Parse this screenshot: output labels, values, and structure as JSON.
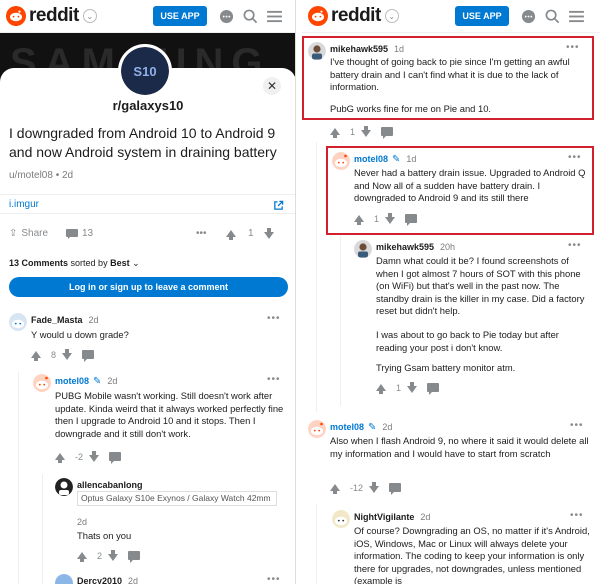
{
  "app": {
    "logo_text": "reddit",
    "use_app_label": "USE APP"
  },
  "left": {
    "banner_text": "SAMSUNG",
    "subreddit": "r/galaxys10",
    "sub_avatar_text": "S10",
    "close_glyph": "✕",
    "post": {
      "title": "I downgraded from Android 10 to Android 9 and now Android system in draining battery",
      "meta": "u/motel08 • 2d",
      "link": "i.imgur"
    },
    "actions": {
      "share": "Share",
      "comments": "13",
      "votes": "1"
    },
    "comments_header": {
      "count_label": "13 Comments",
      "sorted_by": "sorted by",
      "sort_value": "Best"
    },
    "login_button": "Log in or sign up to leave a comment",
    "comments": [
      {
        "author": "Fade_Masta",
        "age": "2d",
        "body": "Y would u down grade?",
        "score": "8"
      },
      {
        "author": "motel08",
        "age": "2d",
        "body": "PUBG Mobile wasn't working. Still doesn't work after update. Kinda weird that it always worked perfectly fine then I upgrade to Android 10 and it stops. Then I downgrade and it still don't work.",
        "score": "-2"
      },
      {
        "author": "allencabanlong",
        "flair": "Optus Galaxy S10e Exynos / Galaxy Watch 42mm",
        "age": "2d",
        "body": "Thats on you",
        "score": "2"
      },
      {
        "author": "Dercy2010",
        "age": "2d"
      }
    ]
  },
  "right": {
    "comments": [
      {
        "author": "mikehawk595",
        "age": "1d",
        "body1": "I've thought of going back to pie since I'm getting an awful battery drain and I can't find what it is due to the lack of information.",
        "body2": "PubG works fine for me on Pie and 10.",
        "score": "1"
      },
      {
        "author": "motel08",
        "age": "1d",
        "body": "Never had a battery drain issue. Upgraded to Android Q and Now all of a sudden have battery drain. I downgraded to Android 9 and its still there",
        "score": "1"
      },
      {
        "author": "mikehawk595",
        "age": "20h",
        "body1": "Damn what could it be? I found screenshots of when I got almost 7 hours of SOT with this phone (on WiFi) but that's well in the past now. The standby drain is the killer in my case. Did a factory reset but didn't help.",
        "body2": "I was about to go back to Pie today but after reading your post i don't know.",
        "body3": "Trying Gsam battery monitor atm.",
        "score": "1"
      },
      {
        "author": "motel08",
        "age": "2d",
        "body": "Also when I flash Android 9, no where it said it would delete all my information and I would have to start from scratch",
        "score": "-12"
      },
      {
        "author": "NightVigilante",
        "age": "2d",
        "body": "Of course? Downgrading an OS, no matter if it's Android, iOS, Windows, Mac or Linux will always delete your information. The coding to keep your information is only there for upgrades, not downgrades, unless mentioned (example is"
      }
    ]
  },
  "colors": {
    "brand": "#ff4500",
    "accent": "#0079d3",
    "highlight": "#d3202e"
  }
}
